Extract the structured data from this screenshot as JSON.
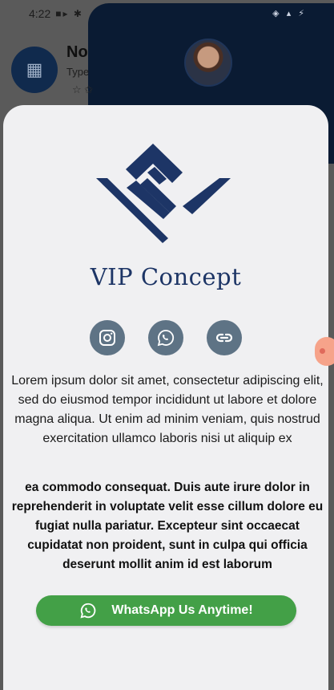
{
  "status_bar": {
    "time": "4:22",
    "left_icons": "■▸ ✱",
    "right_icons": "◈ ▴ ⚡"
  },
  "background": {
    "title": "No",
    "subtitle": "Type",
    "star": "☆ ✩"
  },
  "sheet": {
    "brand_name": "VIP Concept",
    "social": [
      {
        "name": "instagram",
        "icon": "instagram-icon"
      },
      {
        "name": "whatsapp",
        "icon": "whatsapp-icon"
      },
      {
        "name": "website",
        "icon": "link-icon"
      }
    ],
    "description": "Lorem ipsum dolor sit amet, consectetur adipiscing elit, sed do eiusmod tempor incididunt ut labore et dolore magna aliqua. Ut enim ad minim veniam, quis nostrud exercitation ullamco laboris nisi ut aliquip ex",
    "description_bold": "ea commodo consequat. Duis aute irure dolor in reprehenderit in voluptate velit esse cillum dolore eu fugiat nulla pariatur. Excepteur sint occaecat cupidatat non proident, sunt in culpa qui officia deserunt mollit anim id est laborum",
    "cta_label": "WhatsApp Us Anytime!"
  },
  "colors": {
    "sheet_bg": "#f0f0f2",
    "brand": "#1d3566",
    "social_bg": "#5e7385",
    "cta": "#43a047"
  }
}
